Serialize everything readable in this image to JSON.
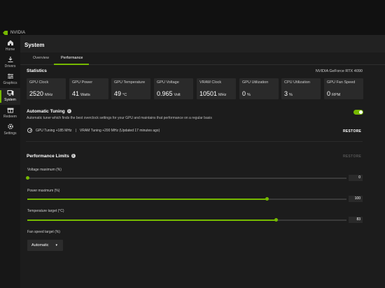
{
  "app": {
    "brand": "NVIDIA",
    "brand_color": "#76b900"
  },
  "sidebar": {
    "items": [
      {
        "label": "Home",
        "icon": "home-icon",
        "active": false
      },
      {
        "label": "Drivers",
        "icon": "download-icon",
        "active": false
      },
      {
        "label": "Graphics",
        "icon": "sliders-icon",
        "active": false
      },
      {
        "label": "System",
        "icon": "monitor-icon",
        "active": true
      },
      {
        "label": "Redeem",
        "icon": "gift-icon",
        "active": false
      },
      {
        "label": "Settings",
        "icon": "gear-icon",
        "active": false
      }
    ]
  },
  "header": {
    "title": "System"
  },
  "tabs": [
    {
      "label": "Overview",
      "active": false
    },
    {
      "label": "Performance",
      "active": true
    }
  ],
  "statistics": {
    "title": "Statistics",
    "gpu_name": "NVIDIA GeForce RTX 4090",
    "cards": [
      {
        "label": "GPU Clock",
        "value": "2520",
        "unit": "MHz"
      },
      {
        "label": "GPU Power",
        "value": "41",
        "unit": "Watts"
      },
      {
        "label": "GPU Temperature",
        "value": "49",
        "unit": "°C"
      },
      {
        "label": "GPU Voltage",
        "value": "0.965",
        "unit": "Volt"
      },
      {
        "label": "VRAM Clock",
        "value": "10501",
        "unit": "MHz"
      },
      {
        "label": "GPU Utilization",
        "value": "0",
        "unit": "%"
      },
      {
        "label": "CPU Utilization",
        "value": "3",
        "unit": "%"
      },
      {
        "label": "GPU Fan Speed",
        "value": "0",
        "unit": "RPM"
      }
    ]
  },
  "auto_tuning": {
    "title": "Automatic Tuning",
    "description": "Automatic tuner which finds the best overclock settings for your GPU and maintains that performance on a regular basis",
    "enabled": true,
    "gpu_tuning": "GPU Tuning +185 MHz",
    "separator": "|",
    "vram_tuning": "VRAM Tuning +200 MHz (Updated 17 minutes ago)",
    "restore_label": "RESTORE"
  },
  "performance_limits": {
    "title": "Performance Limits",
    "restore_label": "RESTORE",
    "sliders": [
      {
        "label": "Voltage maximum (%)",
        "value": "0",
        "fraction": 0.0
      },
      {
        "label": "Power maximum (%)",
        "value": "100",
        "fraction": 0.75
      },
      {
        "label": "Temperature target (°C)",
        "value": "83",
        "fraction": 0.78
      }
    ],
    "fan_speed": {
      "label": "Fan speed target (%)",
      "selected": "Automatic",
      "caret": "▾"
    }
  }
}
